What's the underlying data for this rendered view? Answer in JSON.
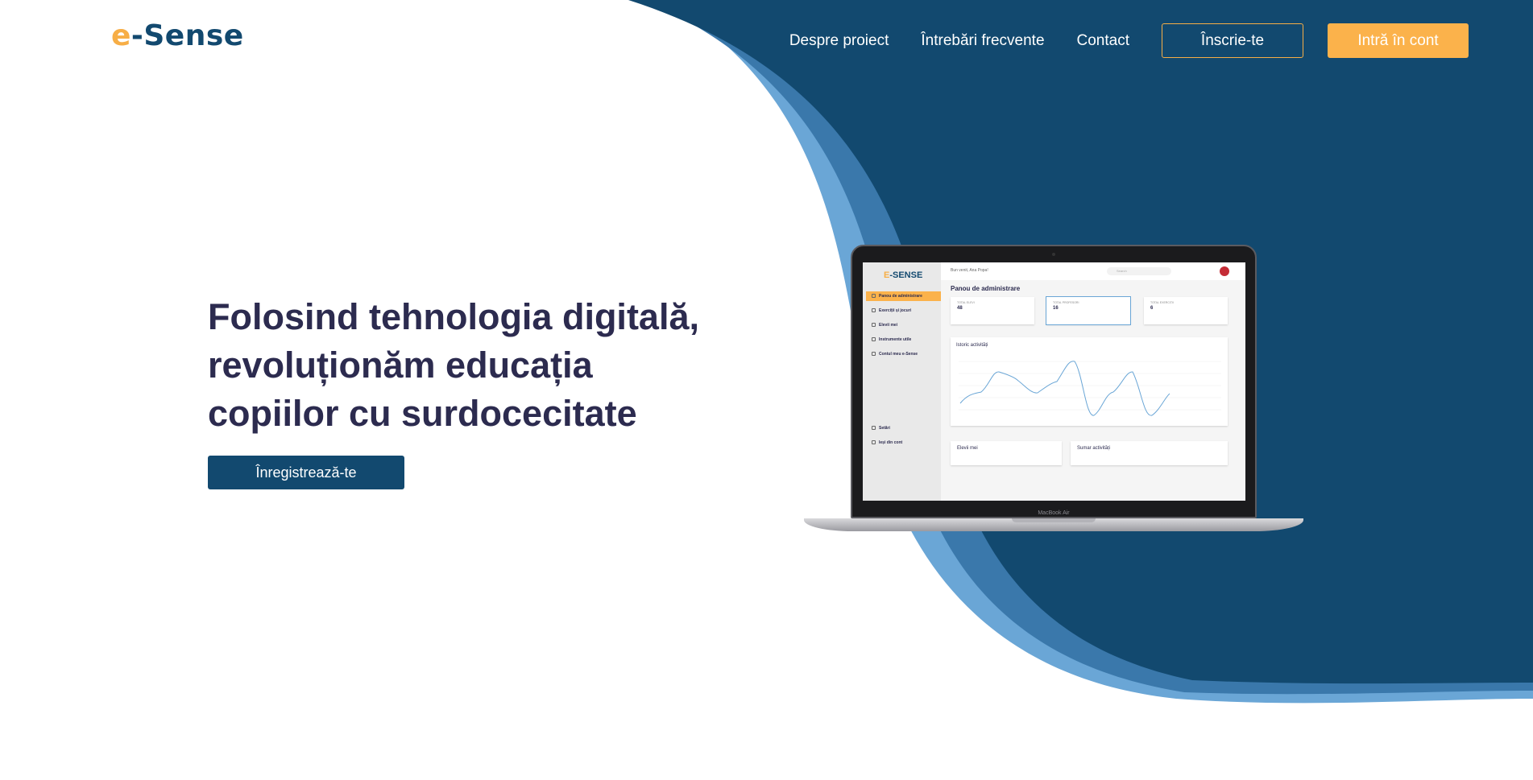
{
  "header": {
    "logo_prefix": "e",
    "logo_rest": "-Sense",
    "nav": [
      "Despre proiect",
      "Întrebări frecvente",
      "Contact"
    ],
    "signup_label": "Înscrie-te",
    "login_label": "Intră în cont"
  },
  "hero": {
    "title_lines": [
      "Folosind tehnologia digitală,",
      "revoluționăm educația",
      "copiilor cu surdocecitate"
    ],
    "cta_label": "Înregistrează-te"
  },
  "colors": {
    "brand_navy": "#12496f",
    "accent_orange": "#fbb24b",
    "wave_light": "#6aa6d6",
    "wave_mid": "#3a78ab",
    "title_text": "#2c2b4f"
  },
  "laptop_screen": {
    "logo_prefix": "E",
    "logo_rest": "-SENSE",
    "greeting": "Bun venit, Ana Popa!",
    "search_placeholder": "Search",
    "page_heading": "Panou de administrare",
    "sidebar": [
      "Panou de administrare",
      "Exerciții și jocuri",
      "Elevii mei",
      "Instrumente utile",
      "Contul meu e-Sense",
      "Setări",
      "Ieși din cont"
    ],
    "cards": [
      {
        "label": "TOTAL ELEVI",
        "value": "48"
      },
      {
        "label": "TOTAL PROFESORI",
        "value": "16"
      },
      {
        "label": "TOTAL EXERCIȚII",
        "value": "6"
      }
    ],
    "graph_title": "Istoric activități",
    "bottom_left": "Elevii mei",
    "bottom_right": "Sumar activități",
    "brand": "MacBook Air"
  }
}
